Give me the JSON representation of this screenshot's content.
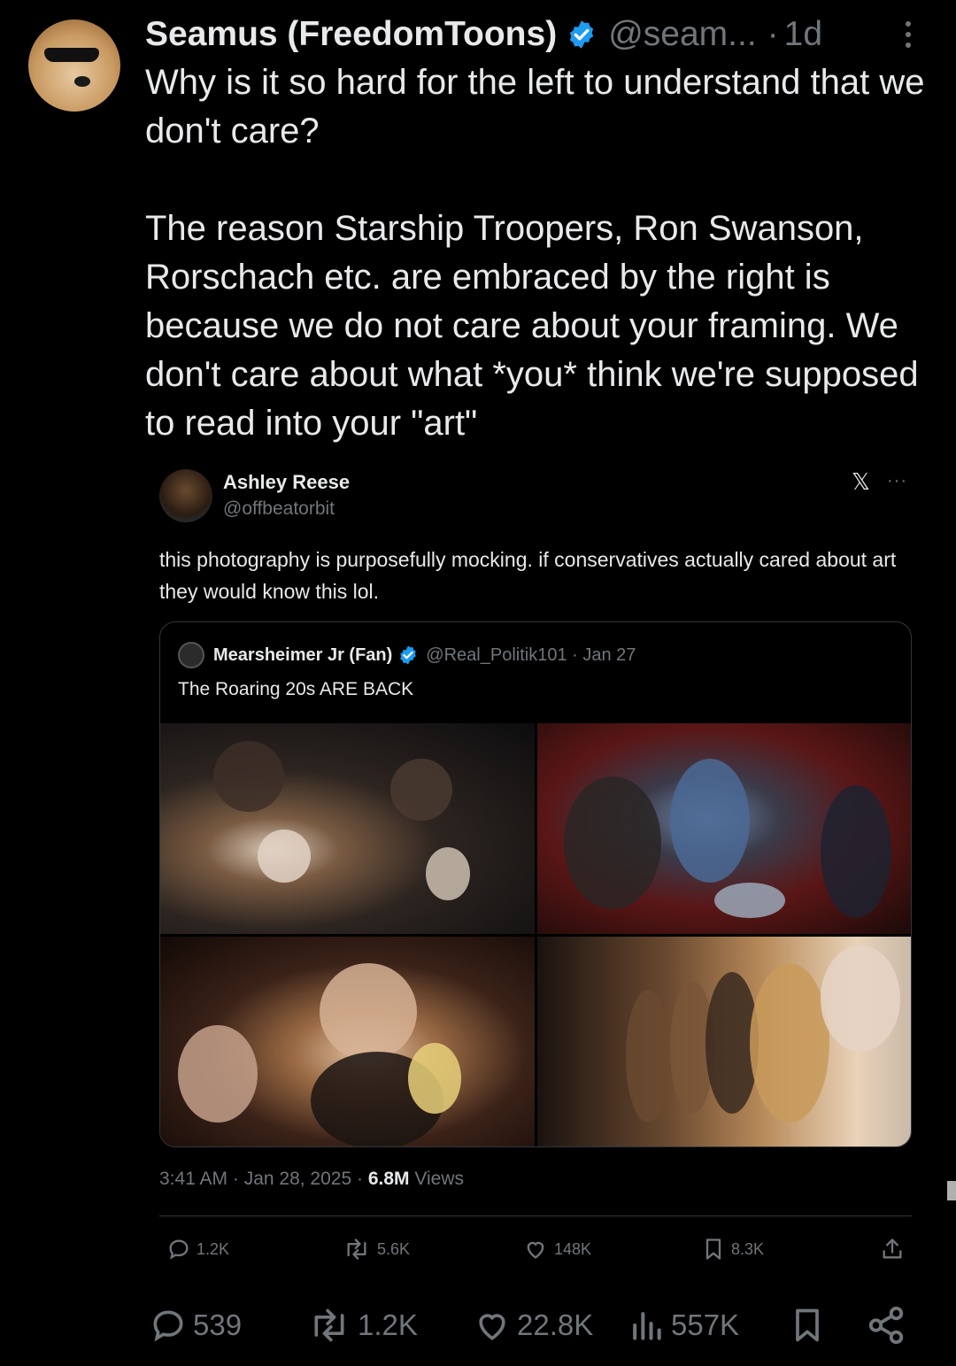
{
  "post": {
    "display_name": "Seamus (FreedomToons)",
    "handle": "@seam...",
    "separator": "·",
    "age": "1d",
    "text": "Why is it so hard for the left to understand that we don't care?\n\nThe reason Starship Troopers, Ron Swanson, Rorschach etc. are embraced by the right is because we do not care about your framing. We don't care about what *you* think we're supposed to read into your \"art\"",
    "accent_color": "#1d9bf0"
  },
  "quoted": {
    "display_name": "Ashley Reese",
    "handle": "@offbeatorbit",
    "x_logo": "𝕏",
    "more": "···",
    "text": "this photography is purposefully mocking. if conservatives actually cared about art they would know this lol.",
    "timestamp": "3:41 AM · Jan 28, 2025 ·",
    "views_count": "6.8M",
    "views_label": "Views",
    "stats": {
      "replies": "1.2K",
      "reposts": "5.6K",
      "likes": "148K",
      "bookmarks": "8.3K"
    }
  },
  "nested_card": {
    "display_name": "Mearsheimer Jr (Fan)",
    "handle_date": "@Real_Politik101 · Jan 27",
    "text": "The Roaring 20s ARE BACK"
  },
  "actions": {
    "replies": "539",
    "reposts": "1.2K",
    "likes": "22.8K",
    "views": "557K"
  },
  "icons": [
    "verified-badge-icon",
    "more-vertical-icon",
    "x-logo-icon",
    "reply-icon",
    "repost-icon",
    "like-icon",
    "bookmark-icon",
    "share-icon",
    "views-icon"
  ]
}
